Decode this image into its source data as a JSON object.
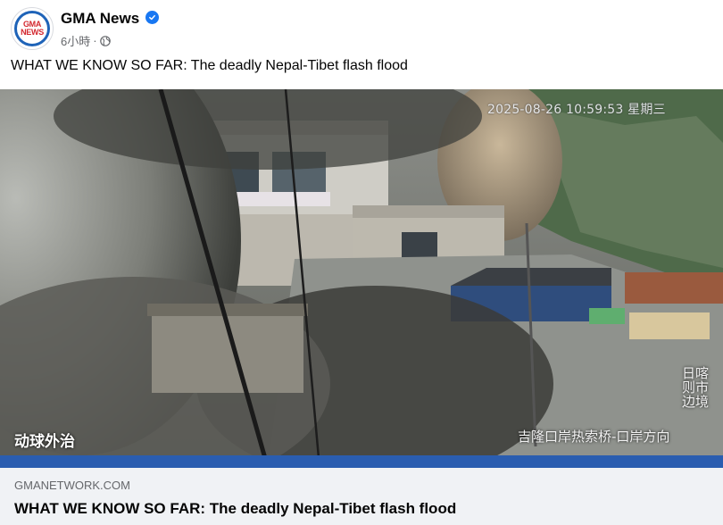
{
  "post": {
    "page_name": "GMA News",
    "time": "6小時",
    "separator": "·",
    "caption": "WHAT WE KNOW SO FAR: The deadly Nepal-Tibet flash flood",
    "avatar": {
      "logo_text_top": "GMA",
      "logo_text_bottom": "NEWS"
    }
  },
  "media": {
    "timestamp": "2025-08-26 10:59:53 星期三",
    "watermark": "动球外治",
    "location_label": "吉隆口岸热索桥-口岸方向",
    "side_label": "日喀则市边境"
  },
  "link_preview": {
    "domain": "GMANETWORK.COM",
    "title": "WHAT WE KNOW SO FAR: The deadly Nepal-Tibet flash flood"
  },
  "colors": {
    "accent": "#1877f2",
    "logo_blue": "#1e63b8",
    "logo_red": "#d3282f"
  },
  "icons": {
    "verified": "verified-badge-icon",
    "audience": "globe-icon"
  }
}
